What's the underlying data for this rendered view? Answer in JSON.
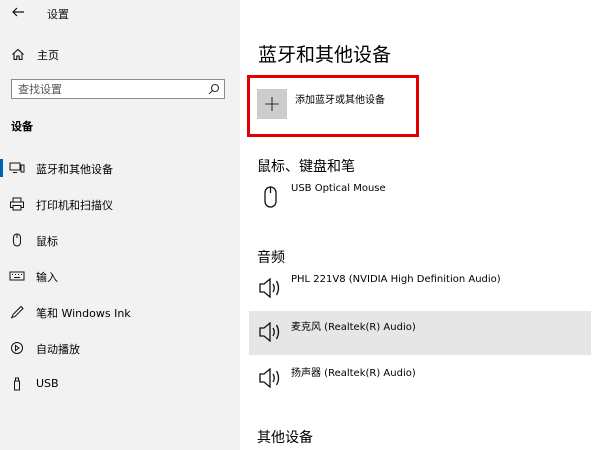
{
  "window": {
    "title": "设置"
  },
  "sidebar": {
    "home_label": "主页",
    "search": {
      "placeholder": "查找设置"
    },
    "section_label": "设备",
    "items": [
      {
        "label": "蓝牙和其他设备",
        "icon": "device-icon",
        "active": true
      },
      {
        "label": "打印机和扫描仪",
        "icon": "printer-icon"
      },
      {
        "label": "鼠标",
        "icon": "mouse-icon"
      },
      {
        "label": "输入",
        "icon": "keyboard-icon"
      },
      {
        "label": "笔和 Windows Ink",
        "icon": "pen-icon"
      },
      {
        "label": "自动播放",
        "icon": "autoplay-icon"
      },
      {
        "label": "USB",
        "icon": "usb-icon"
      }
    ]
  },
  "main": {
    "title": "蓝牙和其他设备",
    "add_device_label": "添加蓝牙或其他设备",
    "mouse_section": {
      "heading": "鼠标、键盘和笔",
      "devices": [
        {
          "name": "USB Optical Mouse",
          "icon": "mouse-icon"
        }
      ]
    },
    "audio_section": {
      "heading": "音频",
      "devices": [
        {
          "name": "PHL 221V8 (NVIDIA High Definition Audio)",
          "icon": "speaker-icon"
        },
        {
          "name": "麦克风 (Realtek(R) Audio)",
          "icon": "speaker-icon",
          "selected": true
        },
        {
          "name": "扬声器 (Realtek(R) Audio)",
          "icon": "speaker-icon"
        }
      ]
    },
    "other_section": {
      "heading": "其他设备"
    }
  },
  "colors": {
    "accent": "#0063b1",
    "highlight_border": "#e00000",
    "sidebar_bg": "#f2f2f2",
    "selected_row": "#e6e6e6"
  }
}
